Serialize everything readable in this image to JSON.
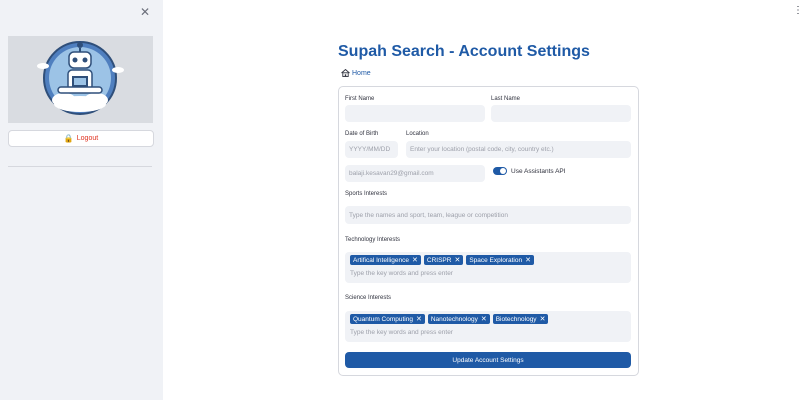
{
  "sidebar": {
    "logout_label": "Logout"
  },
  "header": {
    "title": "Supah Search - Account Settings",
    "home_label": "Home"
  },
  "form": {
    "first_name_label": "First Name",
    "last_name_label": "Last Name",
    "dob_label": "Date of Birth",
    "dob_placeholder": "YYYY/MM/DD",
    "location_label": "Location",
    "location_placeholder": "Enter your location (postal code, city, country etc.)",
    "email_value": "balaji.kesavan29@gmail.com",
    "assistants_toggle_label": "Use Assistants API",
    "assistants_toggle_on": true,
    "sports_label": "Sports Interests",
    "sports_placeholder": "Type the names and sport, team, league or competition",
    "tech_label": "Technology Interests",
    "tech_tags": [
      "Artifical Intelligence",
      "CRISPR",
      "Space Exploration"
    ],
    "tech_placeholder": "Type the key words and press enter",
    "science_label": "Science Interests",
    "science_tags": [
      "Quantum Computing",
      "Nanotechnology",
      "Biotechnology"
    ],
    "science_placeholder": "Type the key words and press enter",
    "submit_label": "Update Account Settings"
  },
  "colors": {
    "accent": "#1f5aa6",
    "sidebar_bg": "#f0f2f6",
    "logout_text": "#e0301e"
  }
}
